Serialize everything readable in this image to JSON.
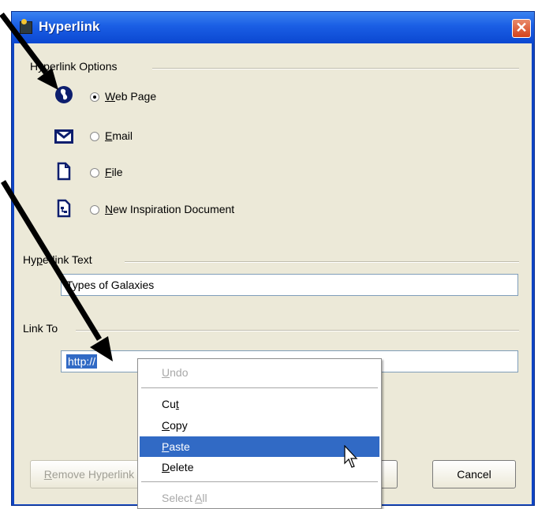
{
  "dialog": {
    "title": "Hyperlink",
    "close_glyph": "✕",
    "colors": {
      "titlebar": "#0b48d1",
      "client": "#ece9d8",
      "selection": "#316ac5",
      "close": "#d4421b"
    }
  },
  "options": {
    "group_label": "Hyperlink Options",
    "items": [
      {
        "label_u": "W",
        "label_rest": "eb Page",
        "icon": "globe-icon",
        "checked": true
      },
      {
        "label_u": "E",
        "label_rest": "mail",
        "icon": "envelope-icon",
        "checked": false
      },
      {
        "label_u": "F",
        "label_rest": "ile",
        "icon": "file-icon",
        "checked": false
      },
      {
        "label_u": "N",
        "label_rest": "ew Inspiration Document",
        "icon": "inspiration-document-icon",
        "checked": false
      }
    ]
  },
  "hyperlink_text": {
    "label_pre": "Hy",
    "label_u": "p",
    "label_post": "erlink Text",
    "value": "Types of Galaxies"
  },
  "link_to": {
    "label": "Link To",
    "value": "http://"
  },
  "buttons": {
    "remove_u": "R",
    "remove_rest": "emove Hyperlink",
    "cancel": "Cancel"
  },
  "context_menu": {
    "undo_u": "U",
    "undo_rest": "ndo",
    "cut_pre": "Cu",
    "cut_u": "t",
    "copy_u": "C",
    "copy_rest": "opy",
    "paste_u": "P",
    "paste_rest": "aste",
    "delete_u": "D",
    "delete_rest": "elete",
    "select_all_pre": "Select ",
    "select_all_u": "A",
    "select_all_post": "ll"
  }
}
